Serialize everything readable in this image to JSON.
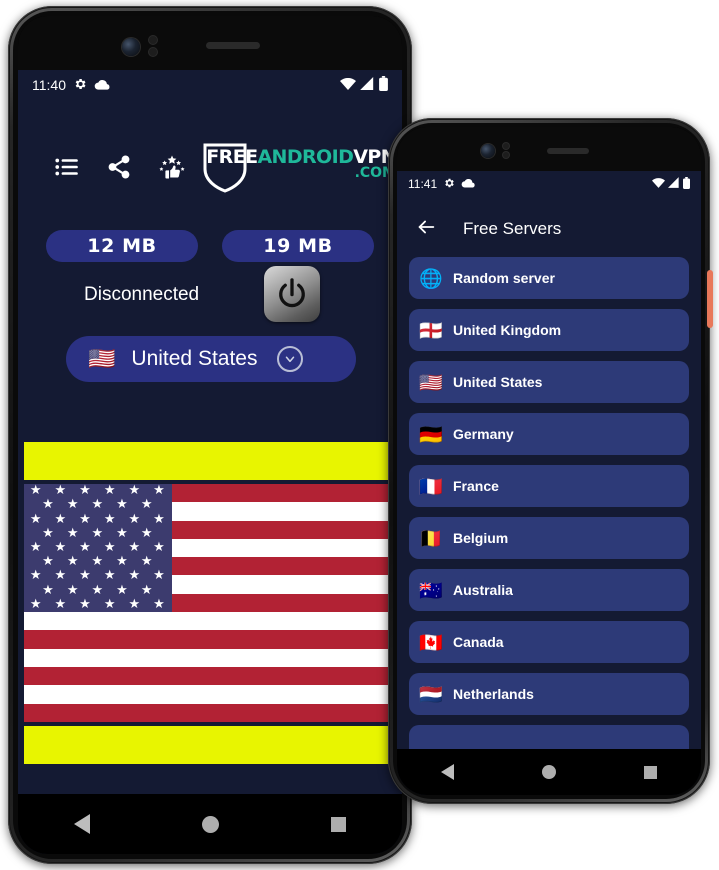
{
  "page": {
    "background": "#ffffff",
    "app_background": "#141a33",
    "accent_blue": "#2b3183",
    "list_item_blue": "#2d3a78",
    "ad_band_color": "#e8f500",
    "logo_teal": "#1fb89a"
  },
  "phone1": {
    "statusbar": {
      "time": "11:40",
      "icons_left": [
        "gear-icon",
        "cloud-icon"
      ],
      "icons_right": [
        "wifi-icon",
        "signal-icon",
        "battery-icon"
      ]
    },
    "toolbar": {
      "icons": [
        {
          "name": "list-icon",
          "label": "Server list"
        },
        {
          "name": "share-icon",
          "label": "Share"
        },
        {
          "name": "rate-thumbs-up-icon",
          "label": "Rate us"
        }
      ]
    },
    "logo": {
      "word1": "FREE",
      "word2": "ANDROID",
      "word3": "VPN",
      "domain": ".COM"
    },
    "usage": {
      "download": "12 MB",
      "upload": "19 MB"
    },
    "connection": {
      "status": "Disconnected",
      "power_button": "power-icon"
    },
    "country_selector": {
      "flag": "🇺🇸",
      "name": "United States",
      "chevron": "chevron-down-icon"
    },
    "navbar": {
      "back": "back-triangle-icon",
      "home": "home-circle-icon",
      "recents": "recents-square-icon"
    }
  },
  "phone2": {
    "statusbar": {
      "time": "11:41",
      "icons_left": [
        "gear-icon",
        "cloud-icon"
      ],
      "icons_right": [
        "wifi-icon",
        "signal-icon",
        "battery-icon"
      ]
    },
    "appbar": {
      "back_icon": "back-arrow-icon",
      "title": "Free Servers"
    },
    "servers": [
      {
        "flag": "🌐",
        "name": "Random server"
      },
      {
        "flag": "🏴󠁧󠁢󠁥󠁮󠁧󠁿",
        "name": "United Kingdom"
      },
      {
        "flag": "🇺🇸",
        "name": "United States"
      },
      {
        "flag": "🇩🇪",
        "name": "Germany"
      },
      {
        "flag": "🇫🇷",
        "name": "France"
      },
      {
        "flag": "🇧🇪",
        "name": "Belgium"
      },
      {
        "flag": "🇦🇺",
        "name": "Australia"
      },
      {
        "flag": "🇨🇦",
        "name": "Canada"
      },
      {
        "flag": "🇳🇱",
        "name": "Netherlands"
      },
      {
        "flag": "",
        "name": ""
      }
    ],
    "navbar": {
      "back": "back-triangle-icon",
      "home": "home-circle-icon",
      "recents": "recents-square-icon"
    },
    "side_button_color": "#e8785a"
  }
}
